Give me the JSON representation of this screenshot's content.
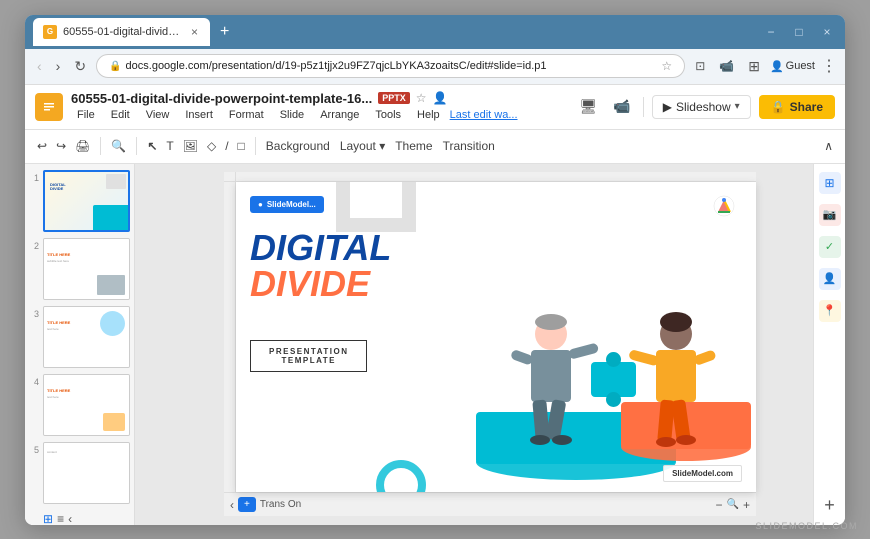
{
  "browser": {
    "tab_title": "60555-01-digital-divide-powerp...",
    "tab_icon": "G",
    "new_tab": "+",
    "window_controls": [
      "−",
      "□",
      "×"
    ],
    "url": "docs.google.com/presentation/d/19-p5z1tjjx2u9FZ7qjcLbYKA3zoaitsC/edit#slide=id.p1",
    "back_disabled": true,
    "reload_icon": "↻",
    "user_label": "Guest",
    "more_icon": "⋮"
  },
  "app": {
    "icon_label": "G",
    "file_title": "60555-01-digital-divide-powerpoint-template-16...",
    "pptx_badge": "PPTX",
    "star_title": "☆",
    "account_icon": "👤",
    "last_edit": "Last edit wa...",
    "slideshow_label": "Slideshow",
    "share_label": "🔒 Share"
  },
  "menu": {
    "items": [
      "File",
      "Edit",
      "View",
      "Insert",
      "Format",
      "Slide",
      "Arrange",
      "Tools",
      "Help"
    ]
  },
  "format_toolbar": {
    "undo_label": "↩",
    "redo_label": "↪",
    "print_label": "🖨",
    "zoom_label": "🔍",
    "cursor_label": "↖",
    "text_label": "T",
    "image_label": "🖼",
    "shapes_label": "◇",
    "line_label": "╱",
    "comment_label": "□",
    "background_label": "Background",
    "layout_label": "Layout ▾",
    "theme_label": "Theme",
    "transition_label": "Transition"
  },
  "slides": [
    {
      "num": "1",
      "active": true
    },
    {
      "num": "2",
      "active": false
    },
    {
      "num": "3",
      "active": false
    },
    {
      "num": "4",
      "active": false
    },
    {
      "num": "5",
      "active": false
    }
  ],
  "slide_content": {
    "logo": "SlideModel...",
    "title_line1": "DIGITAL",
    "title_line2": "DIVIDE",
    "subtitle_line1": "PRESENTATION",
    "subtitle_line2": "TEMPLATE",
    "watermark": "SlideModel.com"
  },
  "bottom_bar": {
    "grid_icon": "⊞",
    "list_icon": "≡",
    "chevron_left": "‹",
    "zoom_minus": "−",
    "zoom_plus": "+",
    "zoom_add": "+",
    "trans_on": "Trans On"
  },
  "right_icons": {
    "items": [
      {
        "id": "slides-icon",
        "label": "⊞",
        "color": "#1a73e8"
      },
      {
        "id": "camera-icon",
        "label": "📷",
        "color": "#ea4335"
      },
      {
        "id": "check-icon",
        "label": "✓",
        "color": "#34a853"
      },
      {
        "id": "person-icon",
        "label": "👤",
        "color": "#4285f4"
      },
      {
        "id": "map-icon",
        "label": "📍",
        "color": "#fbbc04"
      },
      {
        "id": "plus-icon",
        "label": "+",
        "color": "#555"
      }
    ]
  },
  "footer_watermark": "SLIDEMODEL.COM"
}
